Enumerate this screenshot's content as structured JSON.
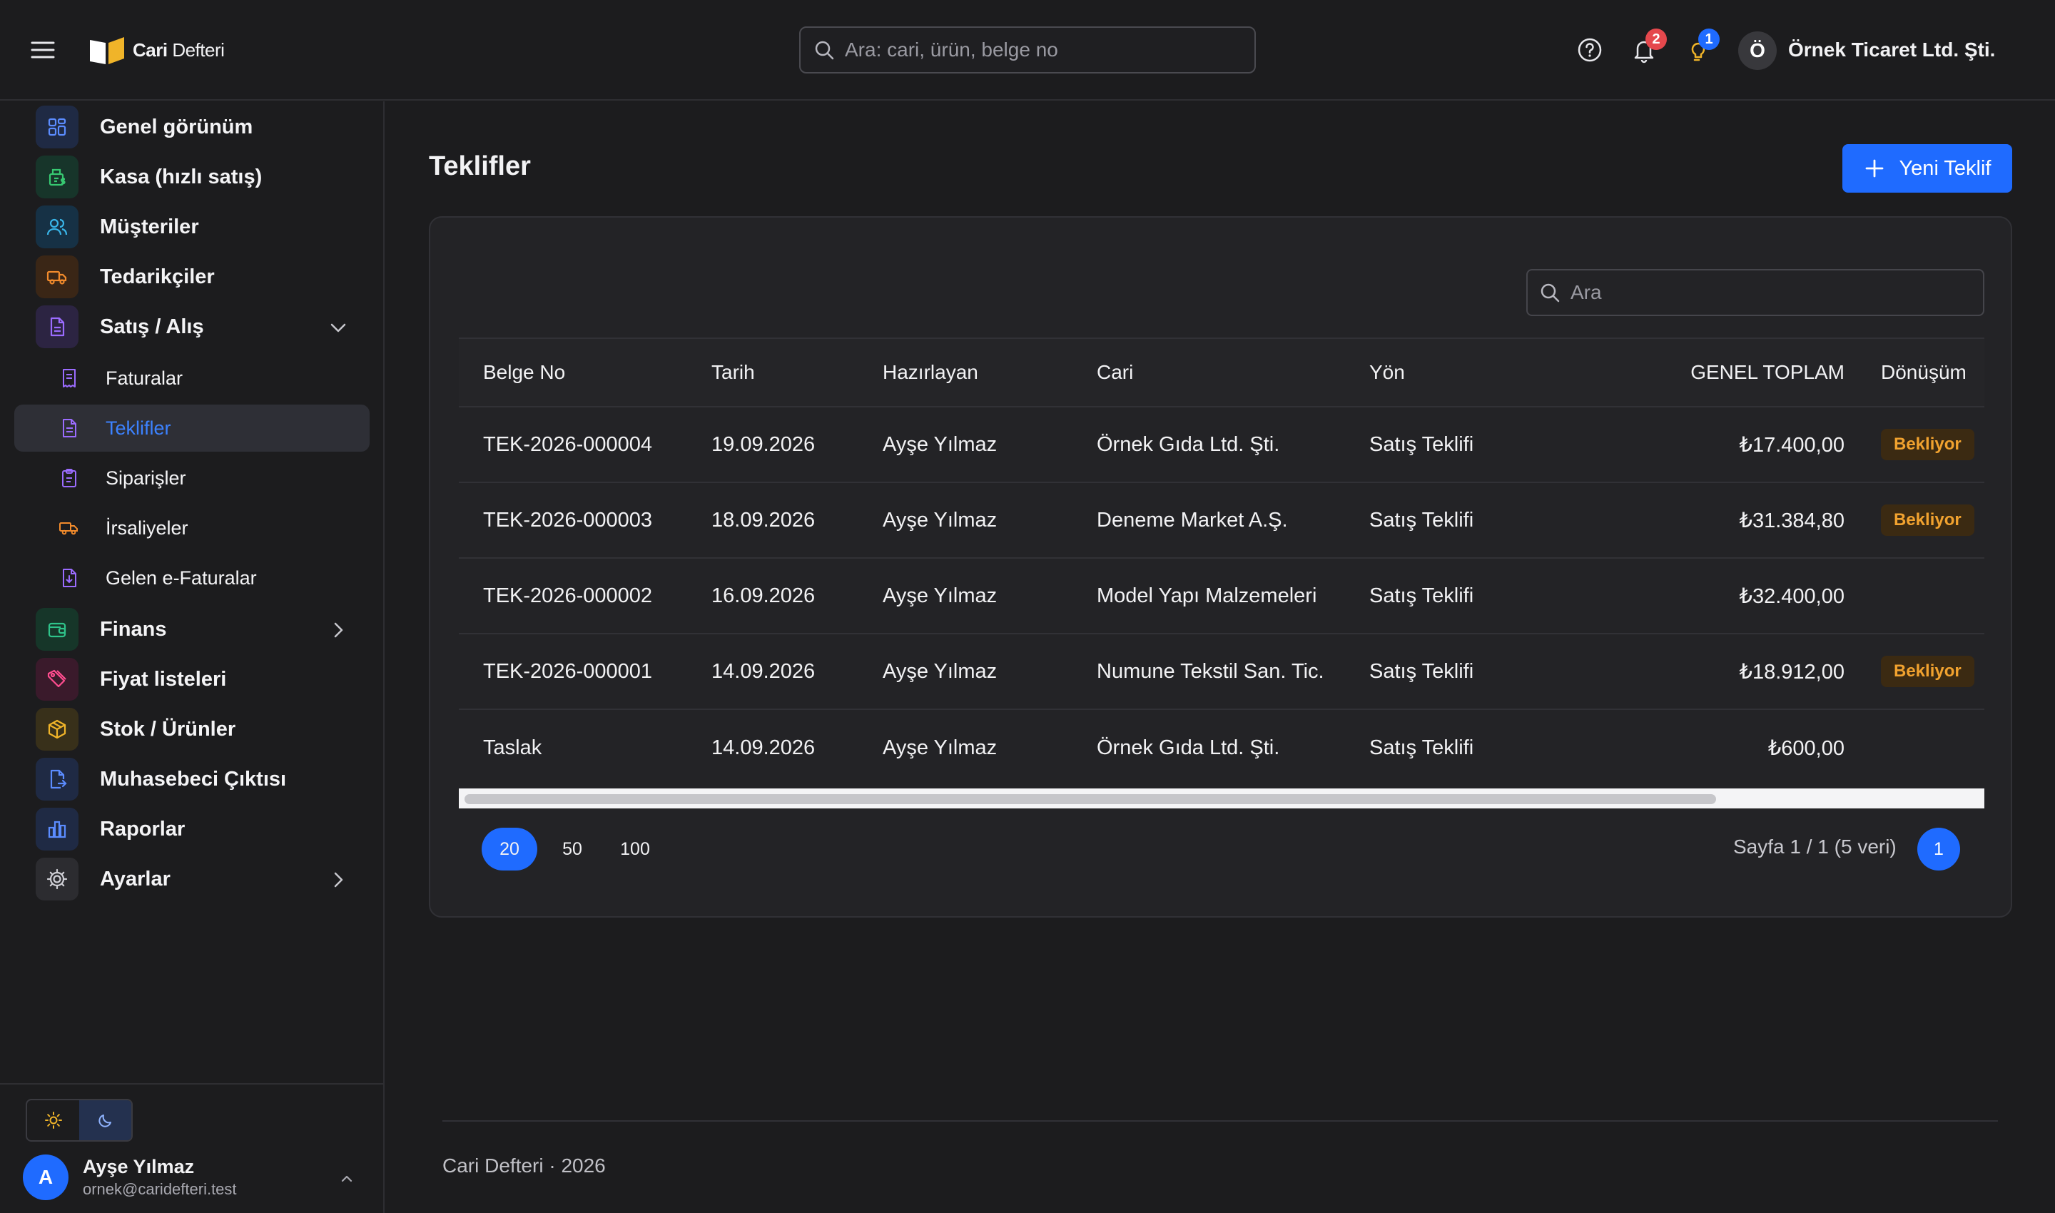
{
  "app": {
    "name_bold": "Cari",
    "name_rest": "Defteri"
  },
  "header": {
    "search_placeholder": "Ara: cari, ürün, belge no",
    "notifications_count": "2",
    "tips_count": "1",
    "company_initial": "Ö",
    "company_name": "Örnek Ticaret Ltd. Şti."
  },
  "sidebar": {
    "items": [
      {
        "label": "Genel görünüm",
        "icon": "dashboard-icon",
        "color": "#5b8cff"
      },
      {
        "label": "Kasa (hızlı satış)",
        "icon": "cash-register-icon",
        "color": "#37c871"
      },
      {
        "label": "Müşteriler",
        "icon": "users-icon",
        "color": "#39b5e8"
      },
      {
        "label": "Tedarikçiler",
        "icon": "truck-icon",
        "color": "#f28b2c"
      },
      {
        "label": "Satış / Alış",
        "icon": "document-icon",
        "color": "#9b6cff"
      },
      {
        "label": "Finans",
        "icon": "wallet-icon",
        "color": "#2fc38a"
      },
      {
        "label": "Fiyat listeleri",
        "icon": "tag-icon",
        "color": "#ff4d8f"
      },
      {
        "label": "Stok / Ürünler",
        "icon": "box-icon",
        "color": "#f0b429"
      },
      {
        "label": "Muhasebeci Çıktısı",
        "icon": "export-file-icon",
        "color": "#5b8cff"
      },
      {
        "label": "Raporlar",
        "icon": "bar-chart-icon",
        "color": "#5b8cff"
      },
      {
        "label": "Ayarlar",
        "icon": "gear-icon",
        "color": "#c8c8ce"
      }
    ],
    "sub_items": [
      {
        "label": "Faturalar",
        "icon": "invoice-icon"
      },
      {
        "label": "Teklifler",
        "icon": "quote-icon"
      },
      {
        "label": "Siparişler",
        "icon": "clipboard-icon"
      },
      {
        "label": "İrsaliyeler",
        "icon": "delivery-truck-icon"
      },
      {
        "label": "Gelen e-Faturalar",
        "icon": "incoming-invoice-icon"
      }
    ],
    "active_sub": "Teklifler"
  },
  "user": {
    "initial": "A",
    "name": "Ayşe Yılmaz",
    "email": "ornek@caridefteri.test"
  },
  "main": {
    "title": "Teklifler",
    "new_button": "Yeni Teklif",
    "table_search_placeholder": "Ara",
    "columns": [
      "Belge No",
      "Tarih",
      "Hazırlayan",
      "Cari",
      "Yön",
      "GENEL TOPLAM",
      "Dönüşüm"
    ],
    "rows": [
      {
        "no": "TEK-2026-000004",
        "date": "19.09.2026",
        "by": "Ayşe Yılmaz",
        "party": "Örnek Gıda Ltd. Şti.",
        "direction": "Satış Teklifi",
        "total": "₺17.400,00",
        "status": "Bekliyor"
      },
      {
        "no": "TEK-2026-000003",
        "date": "18.09.2026",
        "by": "Ayşe Yılmaz",
        "party": "Deneme Market A.Ş.",
        "direction": "Satış Teklifi",
        "total": "₺31.384,80",
        "status": "Bekliyor"
      },
      {
        "no": "TEK-2026-000002",
        "date": "16.09.2026",
        "by": "Ayşe Yılmaz",
        "party": "Model Yapı Malzemeleri",
        "direction": "Satış Teklifi",
        "total": "₺32.400,00",
        "status": ""
      },
      {
        "no": "TEK-2026-000001",
        "date": "14.09.2026",
        "by": "Ayşe Yılmaz",
        "party": "Numune Tekstil San. Tic.",
        "direction": "Satış Teklifi",
        "total": "₺18.912,00",
        "status": "Bekliyor"
      },
      {
        "no": "Taslak",
        "date": "14.09.2026",
        "by": "Ayşe Yılmaz",
        "party": "Örnek Gıda Ltd. Şti.",
        "direction": "Satış Teklifi",
        "total": "₺600,00",
        "status": ""
      }
    ],
    "page_sizes": [
      "20",
      "50",
      "100"
    ],
    "active_page_size": "20",
    "page_info": "Sayfa 1 / 1 (5 veri)",
    "current_page": "1"
  },
  "footer": {
    "text": "Cari Defteri · 2026"
  },
  "colors": {
    "accent": "#1f6bff",
    "status_pending": "#f1a22f"
  }
}
